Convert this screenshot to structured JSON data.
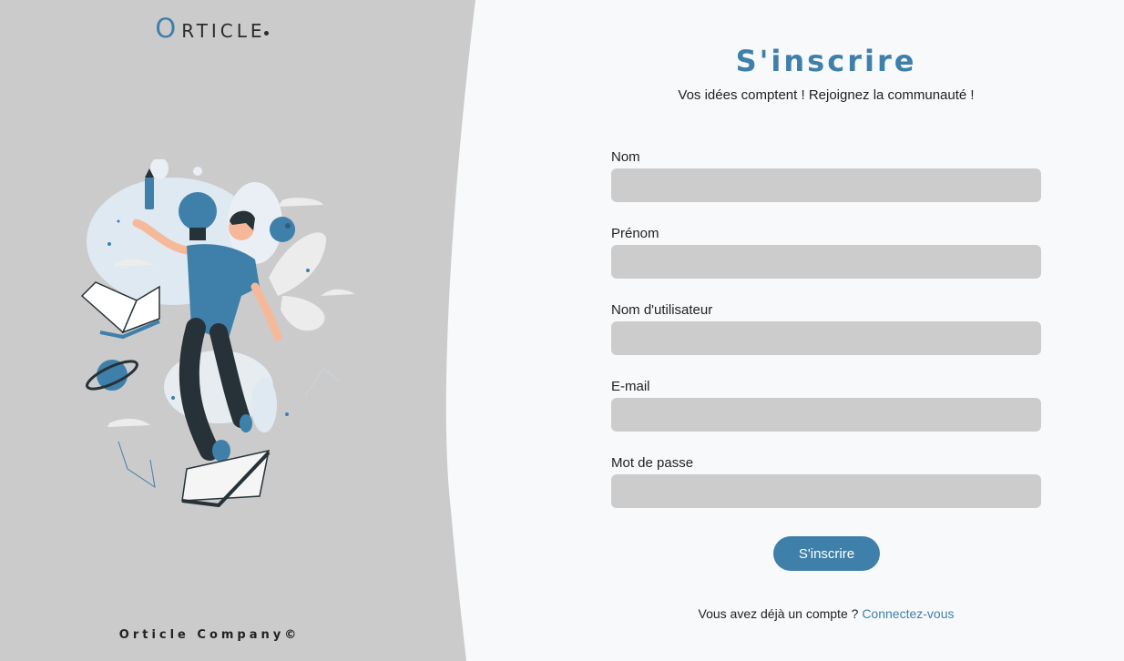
{
  "brand": {
    "logo_initial": "O",
    "logo_rest": "RTICLE",
    "company": "Orticle Company©"
  },
  "illustration": {
    "icon": "person-with-lightbulb-books-planets-illustration"
  },
  "form": {
    "title": "S'inscrire",
    "subtitle": "Vos idées comptent ! Rejoignez la communauté !",
    "fields": [
      {
        "label": "Nom",
        "value": ""
      },
      {
        "label": "Prénom",
        "value": ""
      },
      {
        "label": "Nom d'utilisateur",
        "value": ""
      },
      {
        "label": "E-mail",
        "value": ""
      },
      {
        "label": "Mot de passe",
        "value": ""
      }
    ],
    "submit_label": "S'inscrire",
    "login_prompt": "Vous avez déjà un compte ?",
    "login_link": "Connectez-vous"
  },
  "colors": {
    "accent": "#3f80aa",
    "left_panel_bg": "#cbcbcb",
    "page_bg": "#f7f9fb",
    "input_bg": "#cccccc"
  }
}
